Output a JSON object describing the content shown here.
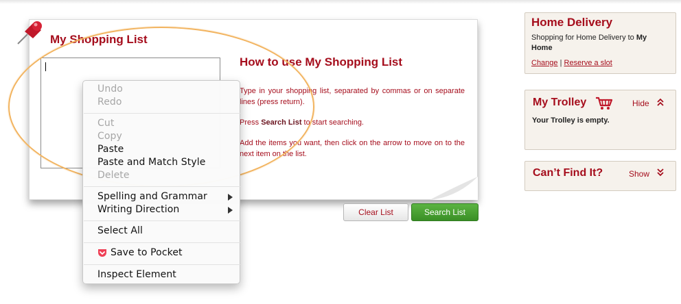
{
  "shopping_list": {
    "title": "My Shopping List",
    "textarea_value": ""
  },
  "howto": {
    "title": "How to use My Shopping List",
    "p1": "Type in your shopping list, separated by commas or on separate lines (press return).",
    "p2_before": "Press ",
    "p2_bold": "Search List",
    "p2_after": " to start searching.",
    "p3": "Add the items you want, then click on the arrow to move on to the next item on the list."
  },
  "buttons": {
    "clear": "Clear List",
    "search": "Search List"
  },
  "home_delivery": {
    "title": "Home Delivery",
    "text_before": "Shopping for Home Delivery to ",
    "text_bold": "My Home",
    "change_link": "Change",
    "separator": "|",
    "reserve_link": "Reserve a slot"
  },
  "trolley": {
    "title": "My Trolley",
    "toggle": "Hide",
    "empty_text": "Your Trolley is empty."
  },
  "cant_find": {
    "title": "Can’t Find It?",
    "toggle": "Show"
  },
  "context_menu": {
    "undo": "Undo",
    "redo": "Redo",
    "cut": "Cut",
    "copy": "Copy",
    "paste": "Paste",
    "paste_match": "Paste and Match Style",
    "delete": "Delete",
    "spelling": "Spelling and Grammar",
    "writing_direction": "Writing Direction",
    "select_all": "Select All",
    "save_pocket": "Save to Pocket",
    "inspect": "Inspect Element"
  },
  "colors": {
    "brand_red": "#a50d1c",
    "search_green": "#4aa233",
    "highlight_orange": "#f2b460",
    "panel_bg": "#f6f2ec",
    "pocket_red": "#ef4056"
  },
  "icons": [
    "push-pin-icon",
    "shopping-cart-icon",
    "chevron-up-icon",
    "chevron-down-icon",
    "pocket-icon",
    "submenu-arrow-icon"
  ]
}
